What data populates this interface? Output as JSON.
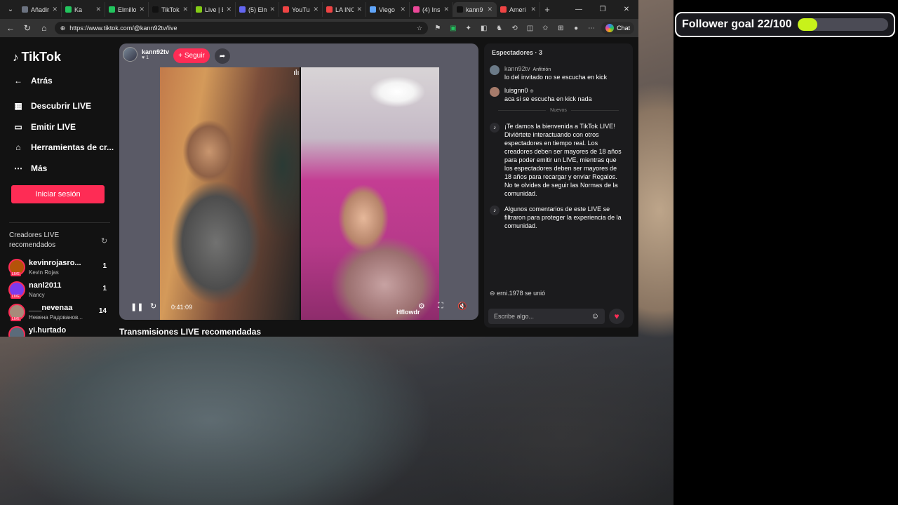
{
  "widget": {
    "follower_goal_label": "Follower goal 22/100",
    "goal_current": 22,
    "goal_target": 100,
    "bar_color": "#c8f21a"
  },
  "browser": {
    "tabs": [
      {
        "title": "Añadir",
        "color": "#6b7280"
      },
      {
        "title": "Ka",
        "color": "#22c55e"
      },
      {
        "title": "Elmillo",
        "color": "#22c55e"
      },
      {
        "title": "TikTok",
        "color": "#111111"
      },
      {
        "title": "Live | E",
        "color": "#84cc16"
      },
      {
        "title": "(5) Elm",
        "color": "#6366f1"
      },
      {
        "title": "YouTu",
        "color": "#ef4444"
      },
      {
        "title": "LA INC",
        "color": "#ef4444"
      },
      {
        "title": "Viego",
        "color": "#60a5fa"
      },
      {
        "title": "(4) Ins",
        "color": "#ec4899"
      },
      {
        "title": "kann9",
        "color": "#111111"
      },
      {
        "title": "Ameri",
        "color": "#ef4444"
      }
    ],
    "url": "https://www.tiktok.com/@kann92tv/live",
    "chat_button": "Chat"
  },
  "sidebar": {
    "logo": "TikTok",
    "back": "Atrás",
    "items": [
      {
        "label": "Descubrir LIVE",
        "icon": "calendar-icon"
      },
      {
        "label": "Emitir LIVE",
        "icon": "video-camera-icon"
      },
      {
        "label": "Herramientas de cr...",
        "icon": "home-icon"
      },
      {
        "label": "Más",
        "icon": "more-icon"
      }
    ],
    "login_button": "Iniciar sesión",
    "creators_title": "Creadores LIVE recomendados",
    "creators": [
      {
        "name": "kevinrojasro...",
        "sub": "Kevin Rojas",
        "count": "1",
        "color": "#b45309"
      },
      {
        "name": "nanl2011",
        "sub": "Nancy",
        "count": "1",
        "color": "#7c3aed"
      },
      {
        "name": "___nevenaa",
        "sub": "Невена Радованов...",
        "count": "14",
        "color": "#a78b7a"
      },
      {
        "name": "yi.hurtado",
        "sub": "",
        "count": "",
        "color": "#5b6b7a"
      }
    ],
    "live_badge": "LIVE"
  },
  "stream": {
    "host": "kann92tv",
    "views": "1",
    "follow_button": "+ Seguir",
    "time": "0:41:09",
    "tag": "Hflowdr"
  },
  "recommend_heading": "Transmisiones LIVE recomendadas",
  "chat": {
    "header": "Espectadores · 3",
    "messages": [
      {
        "user": "kann92tv",
        "role": "Anfitrión",
        "text": "lo del invitado no se escucha en kick"
      },
      {
        "user": "luisgnn0",
        "role": "",
        "text": "aca si se escucha en kick nada"
      }
    ],
    "new_divider": "Nuevos",
    "system": [
      {
        "text": "¡Te damos la bienvenida a TikTok LIVE! Diviértete interactuando con otros espectadores en tiempo real. Los creadores deben ser mayores de 18 años para poder emitir un LIVE, mientras que los espectadores deben ser mayores de 18 años para recargar y enviar Regalos. No te olvides de seguir las Normas de la comunidad."
      },
      {
        "text": "Algunos comentarios de este LIVE se filtraron para proteger la experiencia de la comunidad."
      }
    ],
    "joined_user": "erni.1978",
    "joined_text": "se unió",
    "input_placeholder": "Escribe algo..."
  }
}
